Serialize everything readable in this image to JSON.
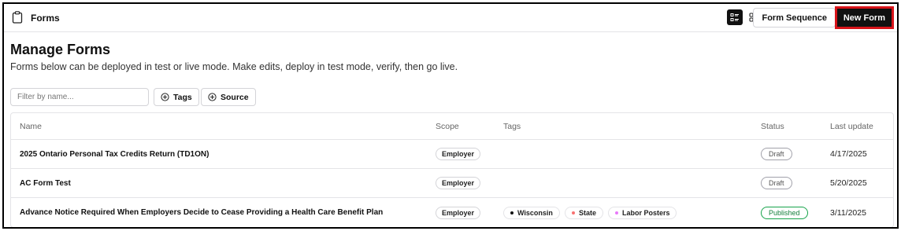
{
  "topbar": {
    "title": "Forms",
    "form_sequence_label": "Form Sequence",
    "new_form_label": "New Form",
    "list_view_icon": "list-view-icon",
    "grid_view_icon": "grid-view-icon",
    "new_form_highlight_color": "#d8141a"
  },
  "page": {
    "title": "Manage Forms",
    "subtitle": "Forms below can be deployed in test or live mode. Make edits, deploy in test mode, verify, then go live."
  },
  "filters": {
    "name_placeholder": "Filter by name...",
    "tags_label": "Tags",
    "source_label": "Source"
  },
  "table": {
    "headers": {
      "name": "Name",
      "scope": "Scope",
      "tags": "Tags",
      "status": "Status",
      "last_update": "Last update"
    },
    "rows": [
      {
        "name": "2025 Ontario Personal Tax Credits Return (TD1ON)",
        "scope": "Employer",
        "tags": [],
        "status": "Draft",
        "last_update": "4/17/2025"
      },
      {
        "name": "AC Form Test",
        "scope": "Employer",
        "tags": [],
        "status": "Draft",
        "last_update": "5/20/2025"
      },
      {
        "name": "Advance Notice Required When Employers Decide to Cease Providing a Health Care Benefit Plan",
        "scope": "Employer",
        "tags": [
          {
            "label": "Wisconsin",
            "color": "#111111"
          },
          {
            "label": "State",
            "color": "#f87171"
          },
          {
            "label": "Labor Posters",
            "color": "#e879f9"
          }
        ],
        "status": "Published",
        "last_update": "3/11/2025"
      }
    ]
  },
  "colors": {
    "published": "#16a34a",
    "draft": "#a1a1aa"
  }
}
